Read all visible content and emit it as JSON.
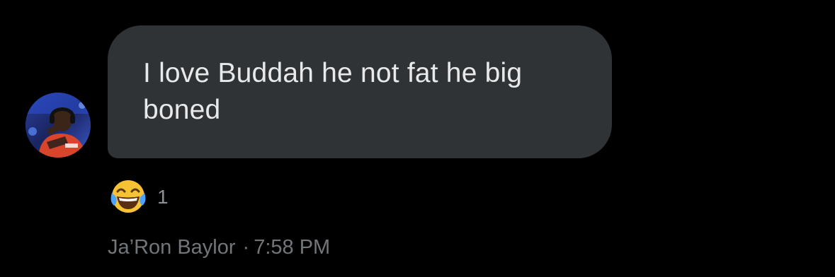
{
  "message": {
    "text": "I love Buddah he not fat he big boned",
    "reaction": {
      "emoji_icon": "face-with-tears-of-joy-icon",
      "count": "1"
    },
    "sender": "Ja’Ron Baylor",
    "separator": "·",
    "time": "7:58 PM"
  },
  "colors": {
    "background": "#000000",
    "bubble": "#2f3336",
    "message_text": "#e7e9ea",
    "meta_text": "#71767b"
  }
}
